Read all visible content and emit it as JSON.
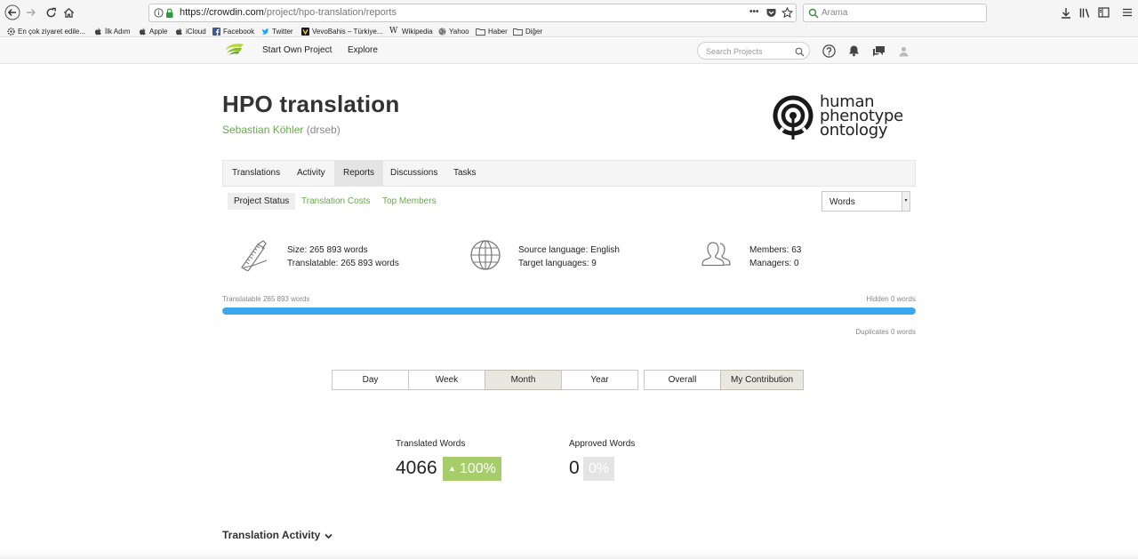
{
  "browser": {
    "url_host": "https://crowdin.com",
    "url_path": "/project/hpo-translation/reports",
    "url_menu": "•••",
    "search_placeholder": "Arama",
    "bookmarks": [
      {
        "label": "En çok ziyaret edile...",
        "icon": "gear-icon"
      },
      {
        "label": "İlk Adım",
        "icon": "apple-icon"
      },
      {
        "label": "Apple",
        "icon": "apple-icon"
      },
      {
        "label": "iCloud",
        "icon": "apple-icon"
      },
      {
        "label": "Facebook",
        "icon": "facebook-icon"
      },
      {
        "label": "Twitter",
        "icon": "twitter-icon"
      },
      {
        "label": "VevoBahis – Türkiye...",
        "icon": "vevo-icon"
      },
      {
        "label": "Wikipedia",
        "icon": "wikipedia-icon"
      },
      {
        "label": "Yahoo",
        "icon": "globe-icon"
      },
      {
        "label": "Haber",
        "icon": "folder-icon"
      },
      {
        "label": "Diğer",
        "icon": "folder-icon"
      }
    ]
  },
  "site": {
    "nav": [
      "Start Own Project",
      "Explore"
    ],
    "search_placeholder": "Search Projects"
  },
  "project": {
    "title": "HPO translation",
    "owner_name": "Sebastian Köhler",
    "owner_handle": "(drseb)",
    "logo_words": [
      "human",
      "phenotype",
      "ontology"
    ]
  },
  "tabs": [
    "Translations",
    "Activity",
    "Reports",
    "Discussions",
    "Tasks"
  ],
  "active_tab": "Reports",
  "subtabs": [
    "Project Status",
    "Translation Costs",
    "Top Members"
  ],
  "active_subtab": "Project Status",
  "units_select": "Words",
  "stats": {
    "size": "Size: 265 893 words",
    "translatable": "Translatable: 265 893 words",
    "source_language": "Source language: English",
    "target_languages": "Target languages: 9",
    "members": "Members: 63",
    "managers": "Managers: 0"
  },
  "progress": {
    "left_label": "Translatable 265 893 words",
    "right_label": "Hidden 0 words",
    "fill_fraction": 1.0,
    "duplicates_label": "Duplicates 0 words"
  },
  "periods": [
    "Day",
    "Week",
    "Month",
    "Year"
  ],
  "active_period": "Month",
  "scopes": [
    "Overall",
    "My Contribution"
  ],
  "active_scope": "My Contribution",
  "counters": {
    "translated_label": "Translated Words",
    "translated_value": "4066",
    "translated_change": "100%",
    "approved_label": "Approved Words",
    "approved_value": "0",
    "approved_change": "0%"
  },
  "activity_title": "Translation Activity",
  "colors": {
    "accent_green": "#6aa84f",
    "badge_green": "#a7cd6a",
    "progress_blue": "#3aa6ec"
  }
}
